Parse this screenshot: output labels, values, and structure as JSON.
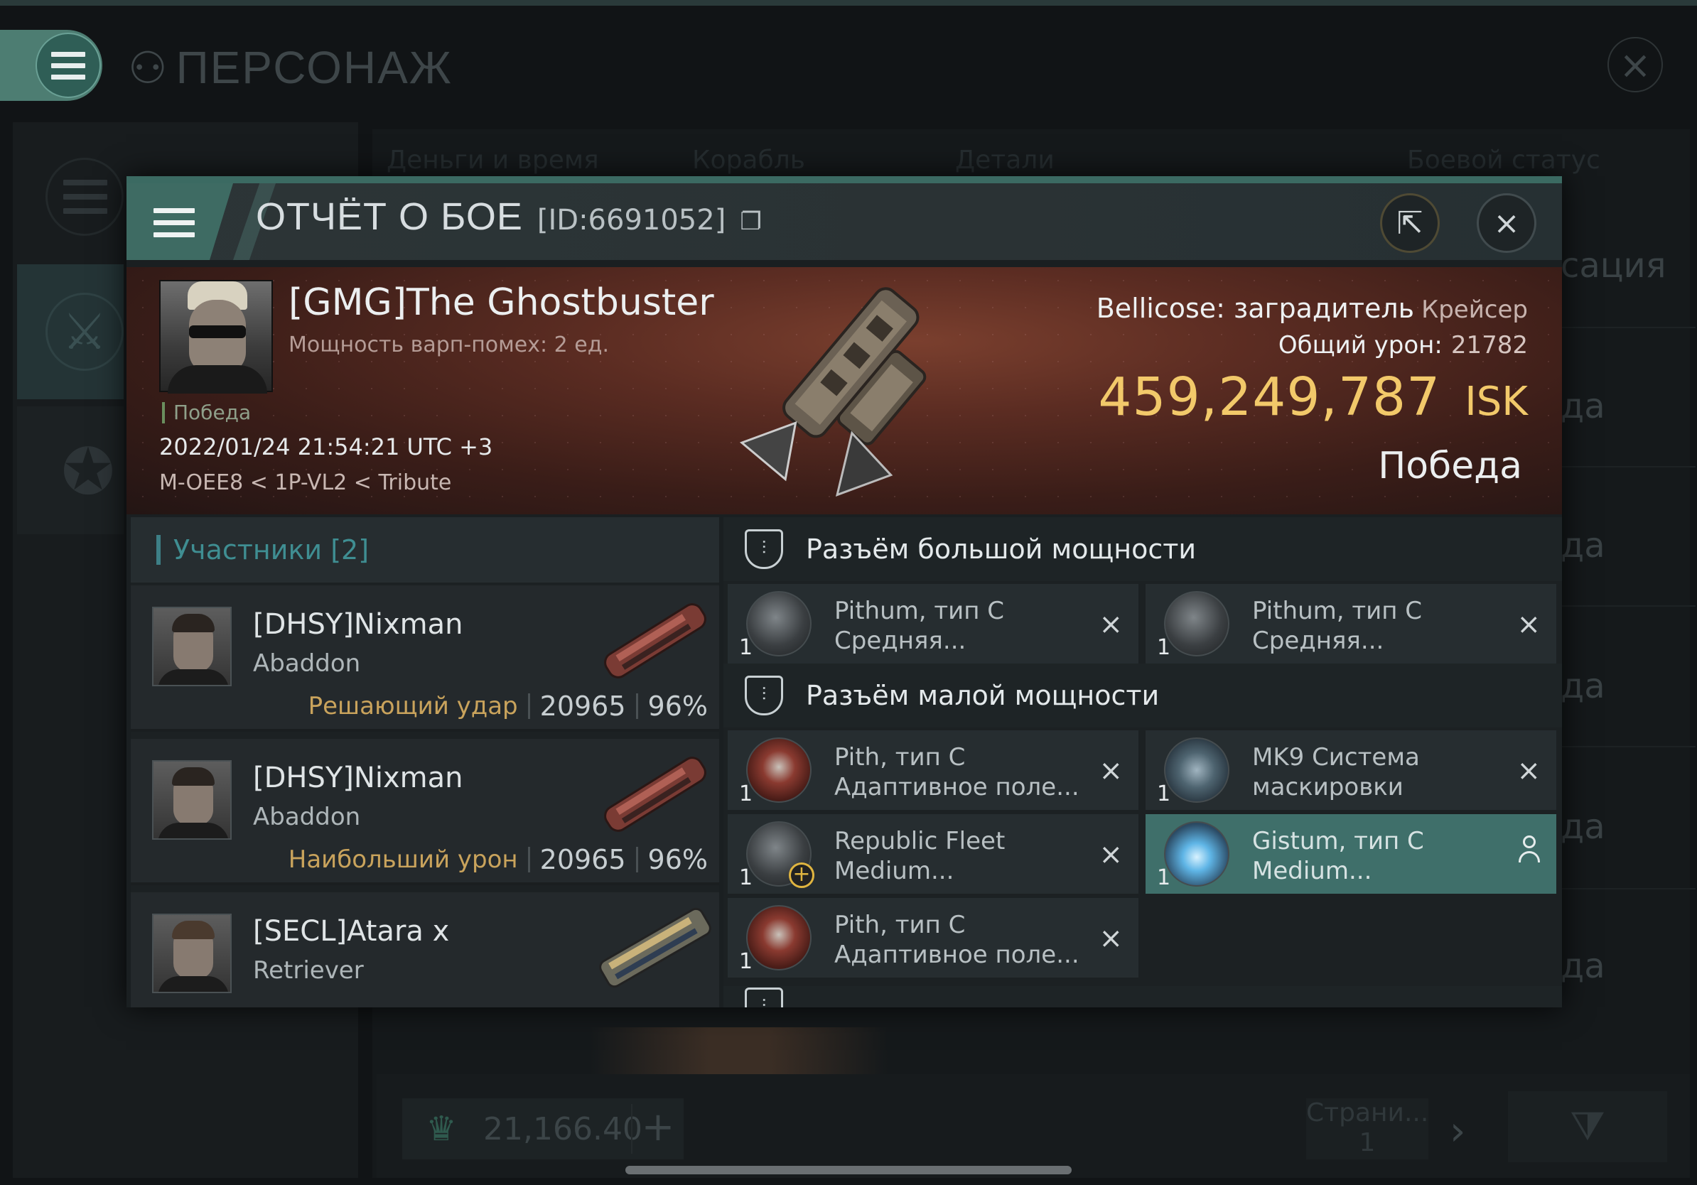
{
  "background": {
    "title": "ПЕРСОНАЖ",
    "tabs": [
      "Деньги и время",
      "Корабль",
      "Детали",
      "Боевой статус"
    ],
    "right_items": [
      "сация",
      "да",
      "да",
      "да",
      "да",
      "да"
    ],
    "credits": "21,166.40",
    "plus": "+",
    "page_label": "Страни...",
    "page_number": "1",
    "next_arrow": "›",
    "close": "×"
  },
  "modal": {
    "title": "ОТЧЁТ О БОЕ",
    "report_id": "[ID:6691052]",
    "copy_icon": "❐",
    "share_icon": "⇱",
    "close_icon": "×",
    "victim": {
      "name": "[GMG]The Ghostbuster",
      "warp_scramble": "Мощность варп-помех: 2 ед.",
      "status": "Победа",
      "datetime": "2022/01/24 21:54:21 UTC +3",
      "location": "M-OEE8 < 1P-VL2 < Tribute",
      "ship": "Bellicose: заградитель",
      "ship_class": "Крейсер",
      "total_damage_label": "Общий урон:",
      "total_damage": "21782",
      "isk_value": "459,249,787",
      "isk_unit": "ISK",
      "outcome": "Победа"
    },
    "participants": {
      "header": "Участники [2]",
      "rows": [
        {
          "name": "[DHSY]Nixman",
          "ship": "Abaddon",
          "tag": "Решающий удар",
          "damage": "20965",
          "percent": "96%"
        },
        {
          "name": "[DHSY]Nixman",
          "ship": "Abaddon",
          "tag": "Наибольший урон",
          "damage": "20965",
          "percent": "96%"
        },
        {
          "name": "[SECL]Atara x",
          "ship": "Retriever",
          "tag": "",
          "damage": "",
          "percent": ""
        }
      ]
    },
    "fitting": {
      "high_slot_label": "Разъём большой мощности",
      "low_slot_label": "Разъём малой мощности",
      "high_modules": [
        {
          "line1": "Pithum, тип C",
          "line2": "Средняя...",
          "qty": "1",
          "icon": "shield-hardener-icon"
        },
        {
          "line1": "Pithum, тип C",
          "line2": "Средняя...",
          "qty": "1",
          "icon": "shield-hardener-icon"
        }
      ],
      "low_modules": [
        {
          "line1": "Pith, тип C",
          "line2": "Адаптивное поле...",
          "qty": "1",
          "icon": "adaptive-field-icon"
        },
        {
          "line1": "MK9 Система",
          "line2": "маскировки",
          "qty": "1",
          "icon": "cloak-icon"
        },
        {
          "line1": "Republic Fleet",
          "line2": "Medium...",
          "qty": "1",
          "icon": "shield-extender-icon"
        },
        {
          "line1": "Gistum, тип C",
          "line2": "Medium...",
          "qty": "1",
          "icon": "shield-booster-icon"
        },
        {
          "line1": "Pith, тип C",
          "line2": "Адаптивное поле...",
          "qty": "1",
          "icon": "adaptive-field-icon"
        }
      ],
      "remove_glyph": "×"
    }
  }
}
